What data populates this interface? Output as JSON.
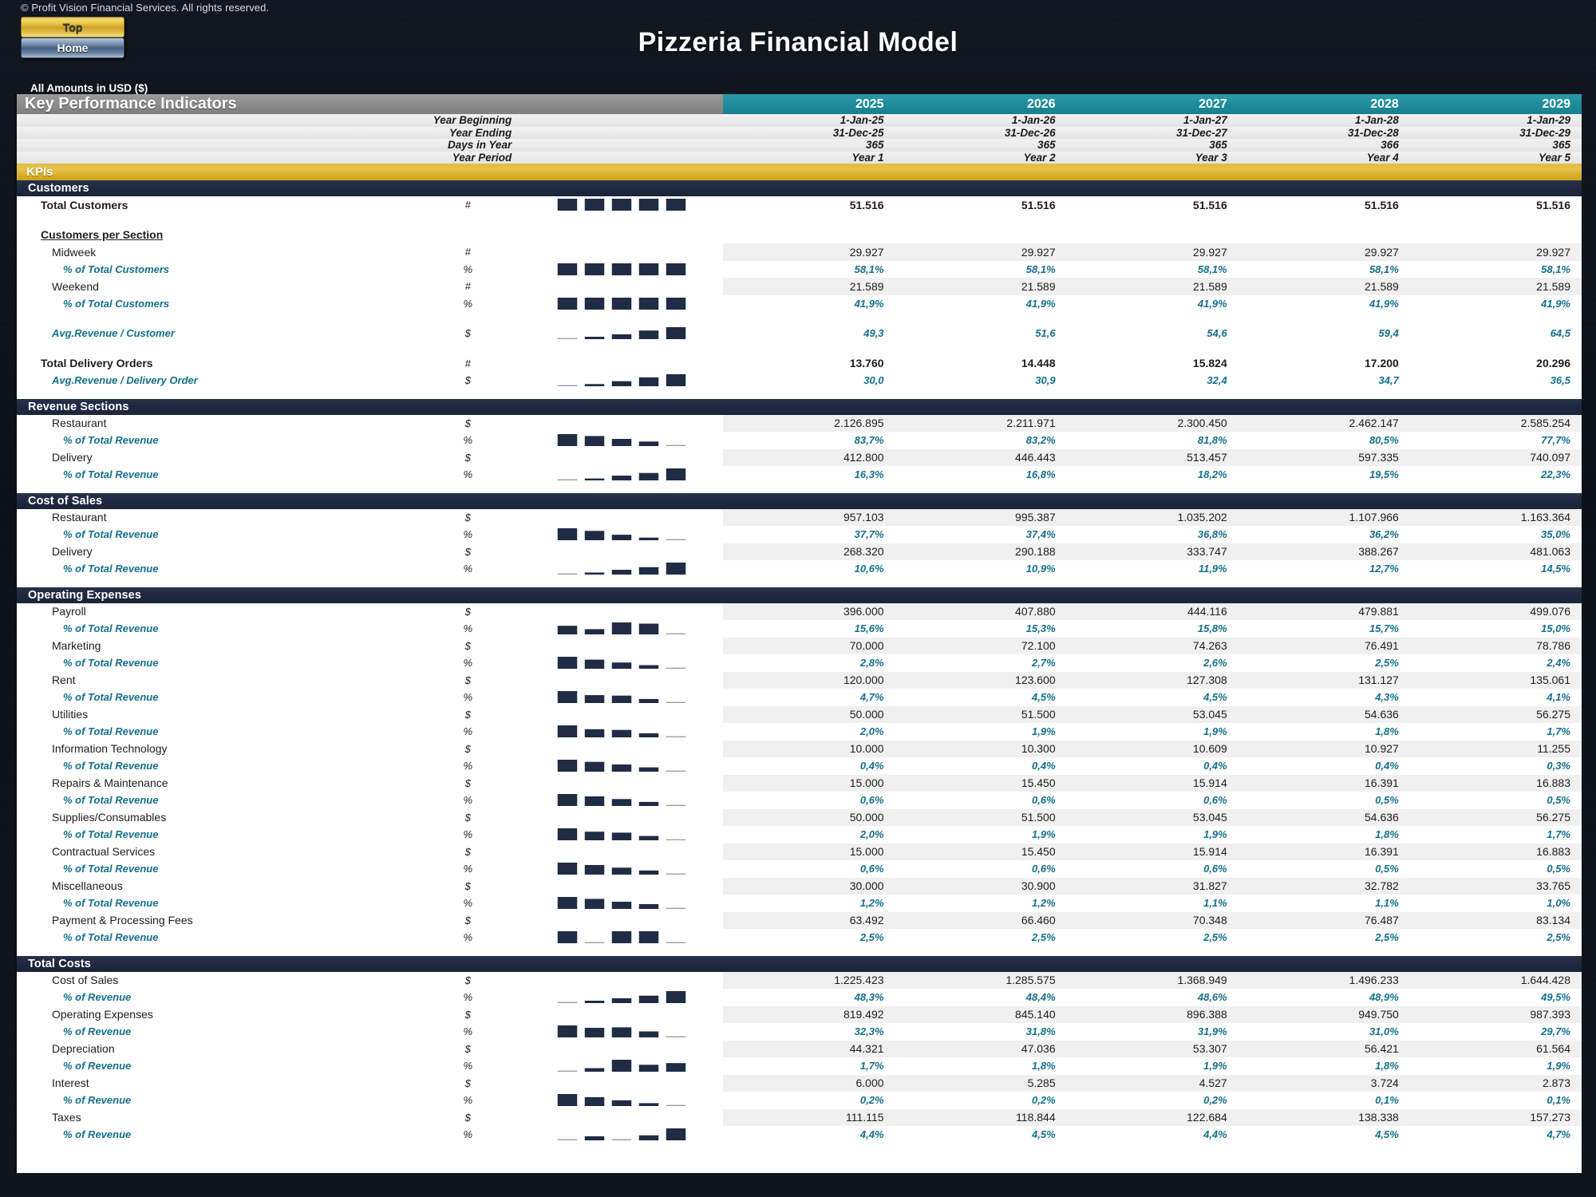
{
  "topbar": {
    "copyright": "© Profit Vision Financial Services. All rights reserved.",
    "btn_top": "Top",
    "btn_home": "Home",
    "title": "Pizzeria Financial Model",
    "amounts_note": "All Amounts in  USD ($)"
  },
  "header": {
    "banner_title": "Key Performance Indicators",
    "years": [
      "2025",
      "2026",
      "2027",
      "2028",
      "2029"
    ],
    "rows": [
      {
        "label": "Year Beginning",
        "values": [
          "1-Jan-25",
          "1-Jan-26",
          "1-Jan-27",
          "1-Jan-28",
          "1-Jan-29"
        ]
      },
      {
        "label": "Year Ending",
        "values": [
          "31-Dec-25",
          "31-Dec-26",
          "31-Dec-27",
          "31-Dec-28",
          "31-Dec-29"
        ]
      },
      {
        "label": "Days in Year",
        "values": [
          "365",
          "365",
          "365",
          "366",
          "365"
        ]
      },
      {
        "label": "Year Period",
        "values": [
          "Year 1",
          "Year 2",
          "Year 3",
          "Year 4",
          "Year 5"
        ]
      }
    ],
    "kpis_bar": "KPIs"
  },
  "sections": [
    {
      "title": "Customers",
      "rows": [
        {
          "label": "Total Customers",
          "unit": "#",
          "style": "bold",
          "values": [
            "51.516",
            "51.516",
            "51.516",
            "51.516",
            "51.516"
          ],
          "spark": [
            1,
            1,
            1,
            1,
            1
          ]
        },
        {
          "label": "",
          "unit": "",
          "style": "gap",
          "values": [
            "",
            "",
            "",
            "",
            ""
          ],
          "spark": []
        },
        {
          "label": "Customers per Section",
          "unit": "",
          "style": "ul",
          "values": [
            "",
            "",
            "",
            "",
            ""
          ],
          "spark": []
        },
        {
          "label": "Midweek",
          "unit": "#",
          "style": "ind1 shade",
          "values": [
            "29.927",
            "29.927",
            "29.927",
            "29.927",
            "29.927"
          ],
          "spark": []
        },
        {
          "label": "% of Total Customers",
          "unit": "%",
          "style": "ind2 pct",
          "values": [
            "58,1%",
            "58,1%",
            "58,1%",
            "58,1%",
            "58,1%"
          ],
          "spark": [
            1,
            1,
            1,
            1,
            1
          ]
        },
        {
          "label": "Weekend",
          "unit": "#",
          "style": "ind1 shade",
          "values": [
            "21.589",
            "21.589",
            "21.589",
            "21.589",
            "21.589"
          ],
          "spark": []
        },
        {
          "label": "% of Total Customers",
          "unit": "%",
          "style": "ind2 pct",
          "values": [
            "41,9%",
            "41,9%",
            "41,9%",
            "41,9%",
            "41,9%"
          ],
          "spark": [
            1,
            1,
            1,
            1,
            1
          ]
        },
        {
          "label": "",
          "unit": "",
          "style": "gap",
          "values": [
            "",
            "",
            "",
            "",
            ""
          ],
          "spark": []
        },
        {
          "label": "Avg.Revenue / Customer",
          "unit": "$",
          "style": "ind1 pct",
          "values": [
            "49,3",
            "51,6",
            "54,6",
            "59,4",
            "64,5"
          ],
          "spark": [
            0.04,
            0.2,
            0.4,
            0.72,
            1
          ]
        },
        {
          "label": "",
          "unit": "",
          "style": "gap",
          "values": [
            "",
            "",
            "",
            "",
            ""
          ],
          "spark": []
        },
        {
          "label": "Total Delivery Orders",
          "unit": "#",
          "style": "bold",
          "values": [
            "13.760",
            "14.448",
            "15.824",
            "17.200",
            "20.296"
          ],
          "spark": []
        },
        {
          "label": "Avg.Revenue / Delivery Order",
          "unit": "$",
          "style": "ind1 pct",
          "values": [
            "30,0",
            "30,9",
            "32,4",
            "34,7",
            "36,5"
          ],
          "spark": [
            0.04,
            0.18,
            0.42,
            0.74,
            1
          ]
        }
      ]
    },
    {
      "title": "Revenue Sections",
      "rows": [
        {
          "label": "Restaurant",
          "unit": "$",
          "style": "ind1 shade",
          "values": [
            "2.126.895",
            "2.211.971",
            "2.300.450",
            "2.462.147",
            "2.585.254"
          ],
          "spark": []
        },
        {
          "label": "% of Total Revenue",
          "unit": "%",
          "style": "ind2 pct",
          "values": [
            "83,7%",
            "83,2%",
            "81,8%",
            "80,5%",
            "77,7%"
          ],
          "spark": [
            1,
            0.84,
            0.6,
            0.38,
            0.05
          ]
        },
        {
          "label": "Delivery",
          "unit": "$",
          "style": "ind1 shade",
          "values": [
            "412.800",
            "446.443",
            "513.457",
            "597.335",
            "740.097"
          ],
          "spark": []
        },
        {
          "label": "% of Total Revenue",
          "unit": "%",
          "style": "ind2 pct",
          "values": [
            "16,3%",
            "16,8%",
            "18,2%",
            "19,5%",
            "22,3%"
          ],
          "spark": [
            0.05,
            0.16,
            0.4,
            0.62,
            1
          ]
        }
      ]
    },
    {
      "title": "Cost of Sales",
      "rows": [
        {
          "label": "Restaurant",
          "unit": "$",
          "style": "ind1 shade",
          "values": [
            "957.103",
            "995.387",
            "1.035.202",
            "1.107.966",
            "1.163.364"
          ],
          "spark": []
        },
        {
          "label": "% of Total Revenue",
          "unit": "%",
          "style": "ind2 pct",
          "values": [
            "37,7%",
            "37,4%",
            "36,8%",
            "36,2%",
            "35,0%"
          ],
          "spark": [
            1,
            0.78,
            0.46,
            0.22,
            0.04
          ]
        },
        {
          "label": "Delivery",
          "unit": "$",
          "style": "ind1 shade",
          "values": [
            "268.320",
            "290.188",
            "333.747",
            "388.267",
            "481.063"
          ],
          "spark": []
        },
        {
          "label": "% of Total Revenue",
          "unit": "%",
          "style": "ind2 pct",
          "values": [
            "10,6%",
            "10,9%",
            "11,9%",
            "12,7%",
            "14,5%"
          ],
          "spark": [
            0.05,
            0.17,
            0.4,
            0.62,
            1
          ]
        }
      ]
    },
    {
      "title": "Operating Expenses",
      "rows": [
        {
          "label": "Payroll",
          "unit": "$",
          "style": "ind1 shade",
          "values": [
            "396.000",
            "407.880",
            "444.116",
            "479.881",
            "499.076"
          ],
          "spark": []
        },
        {
          "label": "% of Total Revenue",
          "unit": "%",
          "style": "ind2 pct",
          "values": [
            "15,6%",
            "15,3%",
            "15,8%",
            "15,7%",
            "15,0%"
          ],
          "spark": [
            0.72,
            0.44,
            1,
            0.9,
            0.05
          ]
        },
        {
          "label": "Marketing",
          "unit": "$",
          "style": "ind1 shade",
          "values": [
            "70.000",
            "72.100",
            "74.263",
            "76.491",
            "78.786"
          ],
          "spark": []
        },
        {
          "label": "% of Total Revenue",
          "unit": "%",
          "style": "ind2 pct",
          "values": [
            "2,8%",
            "2,7%",
            "2,6%",
            "2,5%",
            "2,4%"
          ],
          "spark": [
            1,
            0.76,
            0.52,
            0.3,
            0.05
          ]
        },
        {
          "label": "Rent",
          "unit": "$",
          "style": "ind1 shade",
          "values": [
            "120.000",
            "123.600",
            "127.308",
            "131.127",
            "135.061"
          ],
          "spark": []
        },
        {
          "label": "% of Total Revenue",
          "unit": "%",
          "style": "ind2 pct",
          "values": [
            "4,7%",
            "4,5%",
            "4,5%",
            "4,3%",
            "4,1%"
          ],
          "spark": [
            1,
            0.66,
            0.62,
            0.34,
            0.05
          ]
        },
        {
          "label": "Utilities",
          "unit": "$",
          "style": "ind1 shade",
          "values": [
            "50.000",
            "51.500",
            "53.045",
            "54.636",
            "56.275"
          ],
          "spark": []
        },
        {
          "label": "% of Total Revenue",
          "unit": "%",
          "style": "ind2 pct",
          "values": [
            "2,0%",
            "1,9%",
            "1,9%",
            "1,8%",
            "1,7%"
          ],
          "spark": [
            1,
            0.68,
            0.62,
            0.34,
            0.05
          ]
        },
        {
          "label": "Information Technology",
          "unit": "$",
          "style": "ind1 shade",
          "values": [
            "10.000",
            "10.300",
            "10.609",
            "10.927",
            "11.255"
          ],
          "spark": []
        },
        {
          "label": "% of Total Revenue",
          "unit": "%",
          "style": "ind2 pct",
          "values": [
            "0,4%",
            "0,4%",
            "0,4%",
            "0,4%",
            "0,3%"
          ],
          "spark": [
            1,
            0.82,
            0.6,
            0.36,
            0.05
          ]
        },
        {
          "label": "Repairs & Maintenance",
          "unit": "$",
          "style": "ind1 shade",
          "values": [
            "15.000",
            "15.450",
            "15.914",
            "16.391",
            "16.883"
          ],
          "spark": []
        },
        {
          "label": "% of Total Revenue",
          "unit": "%",
          "style": "ind2 pct",
          "values": [
            "0,6%",
            "0,6%",
            "0,6%",
            "0,5%",
            "0,5%"
          ],
          "spark": [
            1,
            0.8,
            0.58,
            0.34,
            0.05
          ]
        },
        {
          "label": "Supplies/Consumables",
          "unit": "$",
          "style": "ind1 shade",
          "values": [
            "50.000",
            "51.500",
            "53.045",
            "54.636",
            "56.275"
          ],
          "spark": []
        },
        {
          "label": "% of Total Revenue",
          "unit": "%",
          "style": "ind2 pct",
          "values": [
            "2,0%",
            "1,9%",
            "1,9%",
            "1,8%",
            "1,7%"
          ],
          "spark": [
            1,
            0.72,
            0.64,
            0.36,
            0.05
          ]
        },
        {
          "label": "Contractual Services",
          "unit": "$",
          "style": "ind1 shade",
          "values": [
            "15.000",
            "15.450",
            "15.914",
            "16.391",
            "16.883"
          ],
          "spark": []
        },
        {
          "label": "% of Total Revenue",
          "unit": "%",
          "style": "ind2 pct",
          "values": [
            "0,6%",
            "0,6%",
            "0,6%",
            "0,5%",
            "0,5%"
          ],
          "spark": [
            1,
            0.8,
            0.58,
            0.34,
            0.05
          ]
        },
        {
          "label": "Miscellaneous",
          "unit": "$",
          "style": "ind1 shade",
          "values": [
            "30.000",
            "30.900",
            "31.827",
            "32.782",
            "33.765"
          ],
          "spark": []
        },
        {
          "label": "% of Total Revenue",
          "unit": "%",
          "style": "ind2 pct",
          "values": [
            "1,2%",
            "1,2%",
            "1,1%",
            "1,1%",
            "1,0%"
          ],
          "spark": [
            1,
            0.84,
            0.6,
            0.4,
            0.05
          ]
        },
        {
          "label": "Payment & Processing Fees",
          "unit": "$",
          "style": "ind1 shade",
          "values": [
            "63.492",
            "66.460",
            "70.348",
            "76.487",
            "83.134"
          ],
          "spark": []
        },
        {
          "label": "% of Total Revenue",
          "unit": "%",
          "style": "ind2 pct",
          "values": [
            "2,5%",
            "2,5%",
            "2,5%",
            "2,5%",
            "2,5%"
          ],
          "spark": [
            1,
            0,
            1,
            1,
            0
          ]
        }
      ]
    },
    {
      "title": "Total Costs",
      "rows": [
        {
          "label": "Cost of Sales",
          "unit": "$",
          "style": "ind1 shade",
          "values": [
            "1.225.423",
            "1.285.575",
            "1.368.949",
            "1.496.233",
            "1.644.428"
          ],
          "spark": []
        },
        {
          "label": "% of Revenue",
          "unit": "%",
          "style": "ind2 pct",
          "values": [
            "48,3%",
            "48,4%",
            "48,6%",
            "48,9%",
            "49,5%"
          ],
          "spark": [
            0.05,
            0.2,
            0.4,
            0.62,
            1
          ]
        },
        {
          "label": "Operating Expenses",
          "unit": "$",
          "style": "ind1 shade",
          "values": [
            "819.492",
            "845.140",
            "896.388",
            "949.750",
            "987.393"
          ],
          "spark": []
        },
        {
          "label": "% of Revenue",
          "unit": "%",
          "style": "ind2 pct",
          "values": [
            "32,3%",
            "31,8%",
            "31,9%",
            "31,0%",
            "29,7%"
          ],
          "spark": [
            1,
            0.8,
            0.84,
            0.5,
            0.05
          ]
        },
        {
          "label": "Depreciation",
          "unit": "$",
          "style": "ind1 shade",
          "values": [
            "44.321",
            "47.036",
            "53.307",
            "56.421",
            "61.564"
          ],
          "spark": []
        },
        {
          "label": "% of Revenue",
          "unit": "%",
          "style": "ind2 pct",
          "values": [
            "1,7%",
            "1,8%",
            "1,9%",
            "1,8%",
            "1,9%"
          ],
          "spark": [
            0.05,
            0.3,
            1,
            0.58,
            0.72
          ]
        },
        {
          "label": "Interest",
          "unit": "$",
          "style": "ind1 shade",
          "values": [
            "6.000",
            "5.285",
            "4.527",
            "3.724",
            "2.873"
          ],
          "spark": []
        },
        {
          "label": "% of Revenue",
          "unit": "%",
          "style": "ind2 pct",
          "values": [
            "0,2%",
            "0,2%",
            "0,2%",
            "0,1%",
            "0,1%"
          ],
          "spark": [
            1,
            0.74,
            0.48,
            0.24,
            0.05
          ]
        },
        {
          "label": "Taxes",
          "unit": "$",
          "style": "ind1 shade",
          "values": [
            "111.115",
            "118.844",
            "122.684",
            "138.338",
            "157.273"
          ],
          "spark": []
        },
        {
          "label": "% of Revenue",
          "unit": "%",
          "style": "ind2 pct",
          "values": [
            "4,4%",
            "4,5%",
            "4,4%",
            "4,5%",
            "4,7%"
          ],
          "spark": [
            0.05,
            0.34,
            0.1,
            0.42,
            1
          ]
        }
      ]
    }
  ],
  "colors": {
    "teal_header": "#1f8c9b",
    "gold_bar": "#d9ae26",
    "dark_section": "#1e2942",
    "pct_text": "#14708a",
    "spark_bar": "#1f2c44",
    "spark_min": "#9aa0a8"
  }
}
